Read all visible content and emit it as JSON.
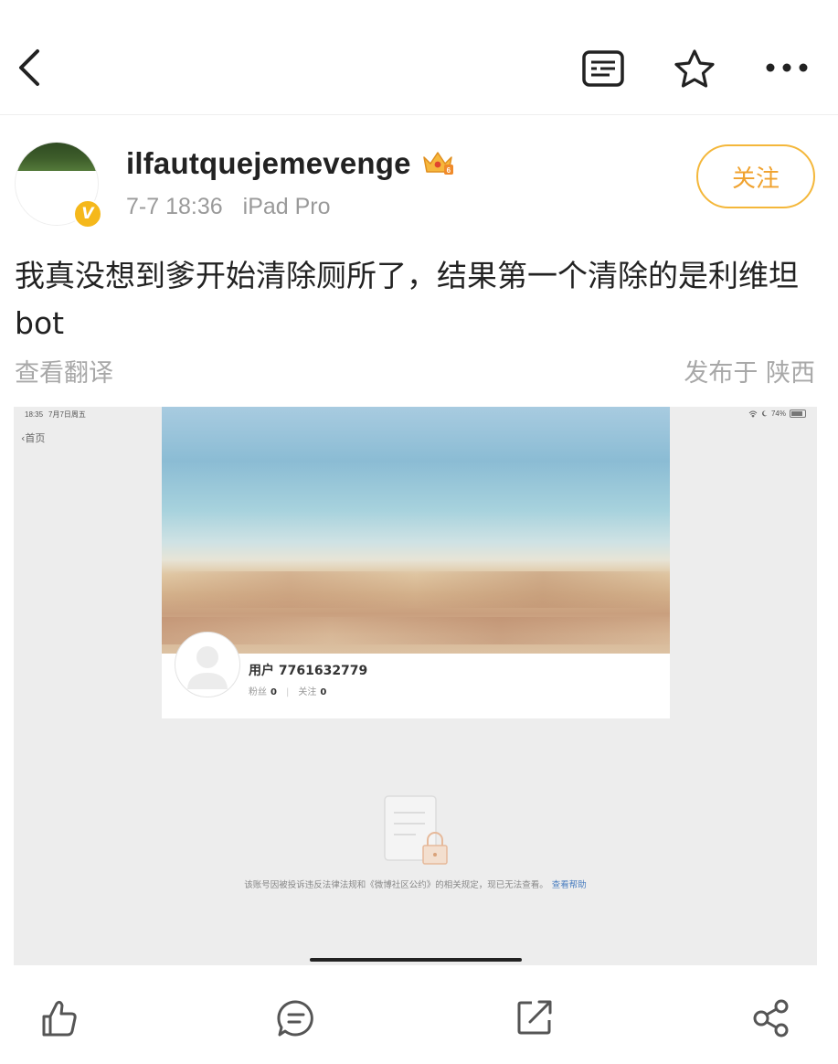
{
  "nav": {
    "back_icon": "chevron-left-icon",
    "reader_icon": "reader-mode-icon",
    "favorite_icon": "star-icon",
    "more_icon": "more-horizontal-icon"
  },
  "author": {
    "username": "ilfautquejemevenge",
    "verified_badge": "V",
    "time": "7-7 18:36",
    "device": "iPad Pro",
    "follow_label": "关注"
  },
  "post": {
    "text": "我真没想到爹开始清除厕所了，结果第一个清除的是利维坦 bot",
    "translate_label": "查看翻译",
    "location": "发布于 陕西"
  },
  "screenshot": {
    "status_time": "18:35",
    "status_date": "7月7日周五",
    "battery": "74%",
    "back_label": "首页",
    "user_name": "用户 7761632779",
    "fans_label": "粉丝",
    "fans_count": "0",
    "follow_label": "关注",
    "follow_count": "0",
    "notice_text": "该账号因被投诉违反法律法规和《微博社区公约》的相关规定，现已无法查看。",
    "help_link": "查看帮助"
  },
  "actions": {
    "like_icon": "thumbs-up-icon",
    "comment_icon": "comment-icon",
    "repost_icon": "repost-icon",
    "share_icon": "share-icon"
  },
  "colors": {
    "accent": "#f4b73a",
    "follow_text": "#f0a22e",
    "meta_gray": "#9a9a9a",
    "link_blue": "#4a7ec0"
  }
}
